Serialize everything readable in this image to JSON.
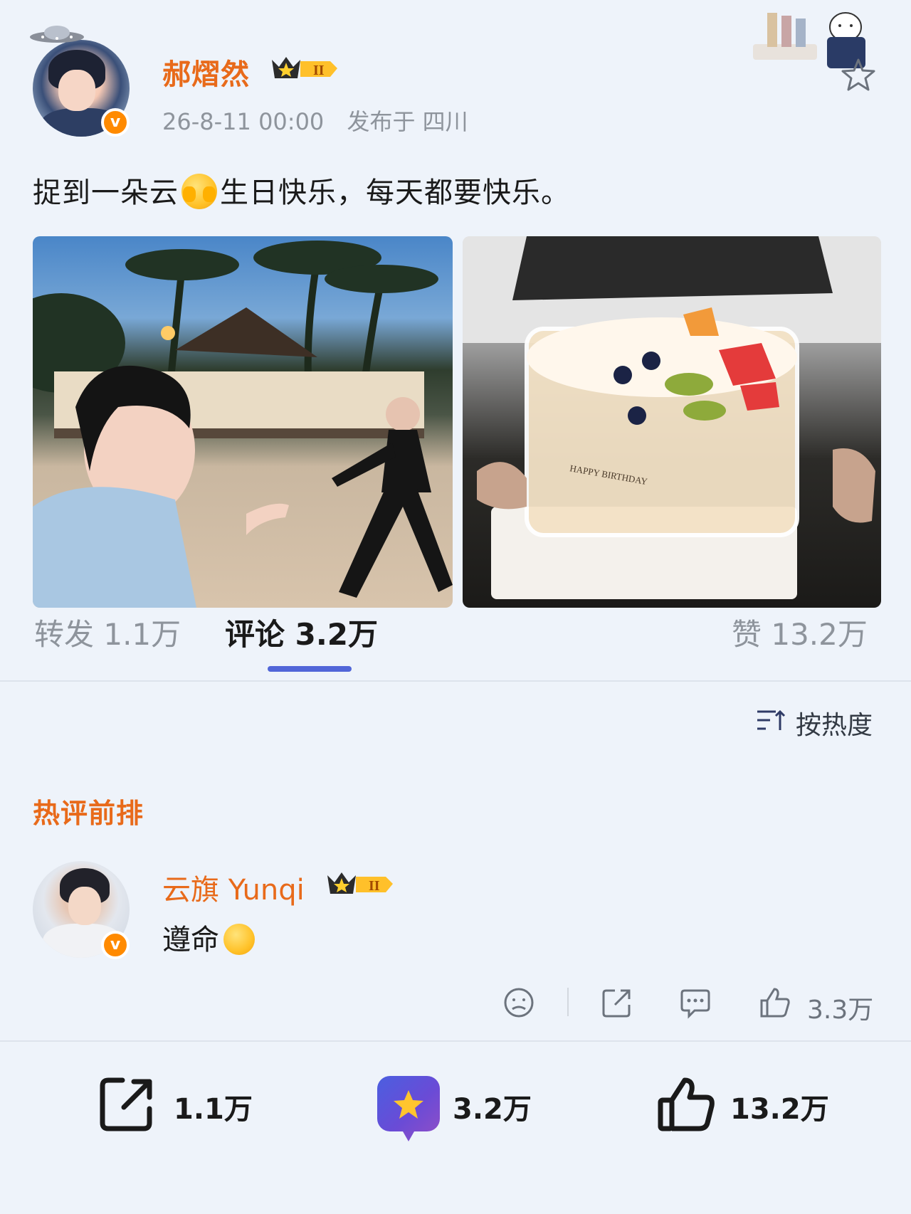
{
  "post": {
    "author_name": "郝熠然",
    "author_level": "II",
    "verified_mark": "v",
    "timestamp": "26-8-11 00:00",
    "location_text": "发布于 四川",
    "text_part1": "捉到一朵云",
    "text_part2": "生日快乐，每天都要快乐。"
  },
  "photos": [
    {
      "name": "beach-photo"
    },
    {
      "name": "cake-photo",
      "caption_text": "HAPPY BIRTHDAY"
    }
  ],
  "tabs": {
    "repost": "转发 1.1万",
    "comment": "评论 3.2万",
    "like": "赞 13.2万"
  },
  "sort": {
    "label": "按热度"
  },
  "hot_section": {
    "title": "热评前排"
  },
  "comment": {
    "author_name": "云旗 Yunqi",
    "author_level": "II",
    "verified_mark": "v",
    "text": "遵命",
    "like_count": "3.3万"
  },
  "bottom_bar": {
    "repost_count": "1.1万",
    "comment_count": "3.2万",
    "like_count": "13.2万"
  },
  "colors": {
    "accent_orange": "#e86a1a",
    "tab_underline": "#5166d8",
    "background": "#eef3fa"
  },
  "icons": [
    "ufo-icon",
    "star-icon",
    "sort-icon",
    "dislike-icon",
    "share-icon",
    "comment-icon",
    "like-icon"
  ]
}
